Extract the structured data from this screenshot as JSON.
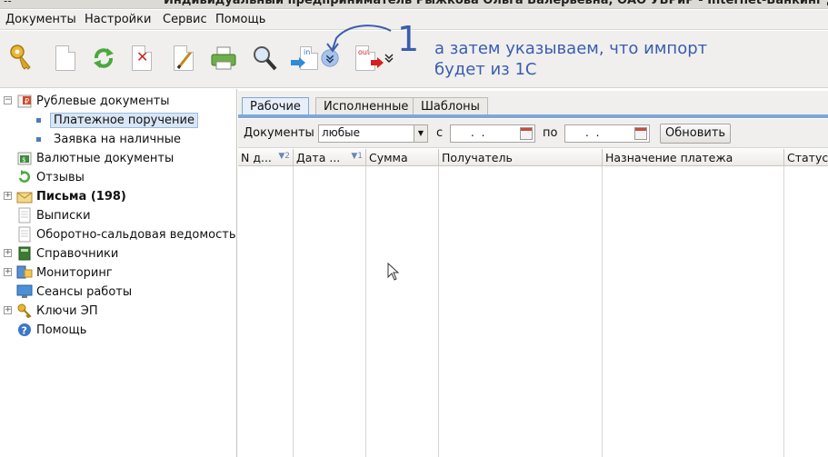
{
  "window": {
    "title": "Индивидуальный предприниматель Рыжкова Ольга Валерьевна, ОАО УБРиР - Internet-Банкинг для корп",
    "dash": "--"
  },
  "menu": [
    "Документы",
    "Настройки",
    "Сервис",
    "Помощь"
  ],
  "toolbar": {
    "icons": [
      "key-icon",
      "new-document-icon",
      "refresh-icon",
      "delete-icon",
      "edit-icon",
      "print-icon",
      "search-icon",
      "import-icon",
      "import-dropdown-icon",
      "export-icon",
      "export-dropdown-icon"
    ],
    "import_label": "in",
    "export_label": "out"
  },
  "annotation": {
    "number": "1",
    "text": "а затем указываем, что импорт будет из 1С"
  },
  "tree": {
    "items": [
      {
        "label": "Рублевые документы",
        "expander": "−",
        "bold": false
      },
      {
        "label": "Платежное поручение",
        "selected": true
      },
      {
        "label": "Заявка на наличные"
      },
      {
        "label": "Валютные документы"
      },
      {
        "label": "Отзывы"
      },
      {
        "label": "Письма (198)",
        "expander": "+",
        "bold": true
      },
      {
        "label": "Выписки"
      },
      {
        "label": "Оборотно-сальдовая ведомость"
      },
      {
        "label": "Справочники",
        "expander": "+"
      },
      {
        "label": "Мониторинг",
        "expander": "+"
      },
      {
        "label": "Сеансы работы"
      },
      {
        "label": "Ключи ЭП",
        "expander": "+"
      },
      {
        "label": "Помощь"
      }
    ]
  },
  "tabs": [
    "Рабочие",
    "Исполненные",
    "Шаблоны"
  ],
  "active_tab": "Рабочие",
  "filter": {
    "documents_label": "Документы",
    "documents_value": "любые",
    "from_label": "с",
    "from_value": ". .",
    "to_label": "по",
    "to_value": ". .",
    "refresh_button": "Обновить"
  },
  "grid": {
    "columns": [
      {
        "label": "N д...",
        "sort": "▼2"
      },
      {
        "label": "Дата ...",
        "sort": "▼1"
      },
      {
        "label": "Сумма",
        "sort": ""
      },
      {
        "label": "Получатель",
        "sort": ""
      },
      {
        "label": "Назначение платежа",
        "sort": ""
      },
      {
        "label": "Статус",
        "sort": ""
      }
    ],
    "rows": []
  },
  "colors": {
    "accent": "#7fa7d6",
    "annotation": "#3a5db0",
    "selection": "#d8e6f5"
  }
}
